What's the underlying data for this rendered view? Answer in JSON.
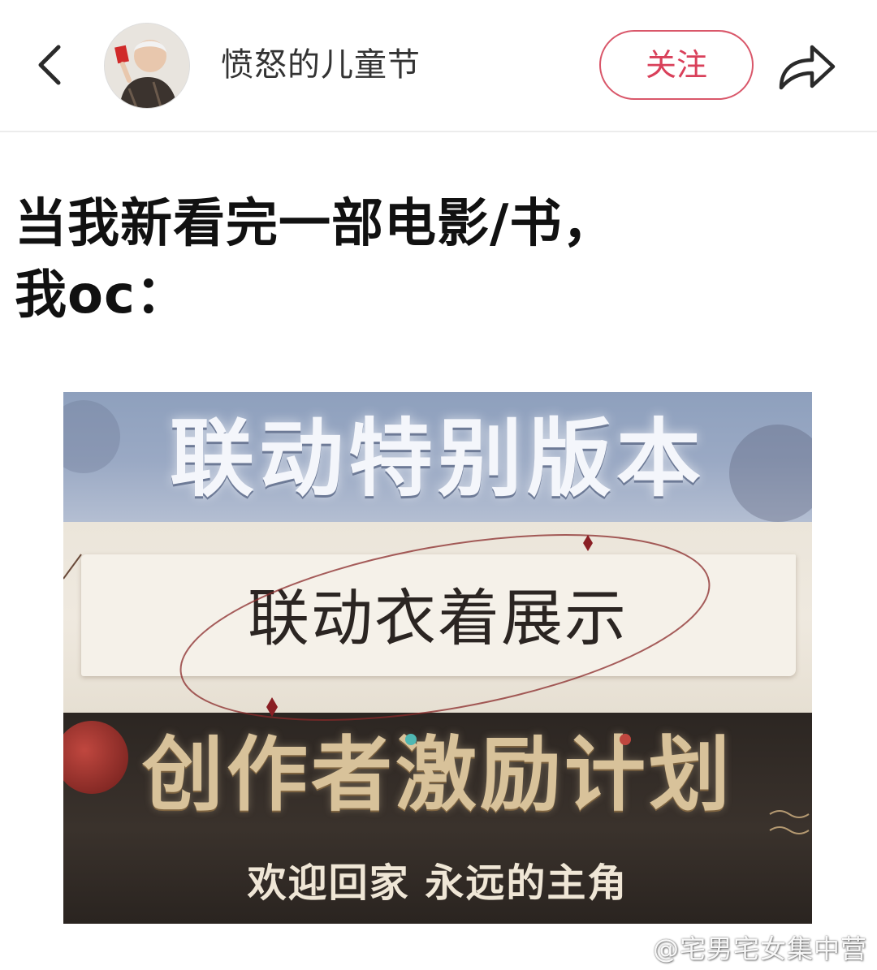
{
  "header": {
    "author_name": "愤怒的儿童节",
    "follow_label": "关注",
    "back_icon": "chevron-left-icon",
    "share_icon": "share-arrow-icon",
    "accent_color": "#d9405a"
  },
  "post": {
    "text_line1": "当我新看完一部电影/书，",
    "text_line2": "我oc："
  },
  "meme": {
    "top_title": "联动特别版本",
    "middle_title": "联动衣着展示",
    "bottom_title": "创作者激励计划",
    "bottom_subtitle": "欢迎回家 永远的主角"
  },
  "watermark": {
    "text": "@宅男宅女集中营"
  }
}
